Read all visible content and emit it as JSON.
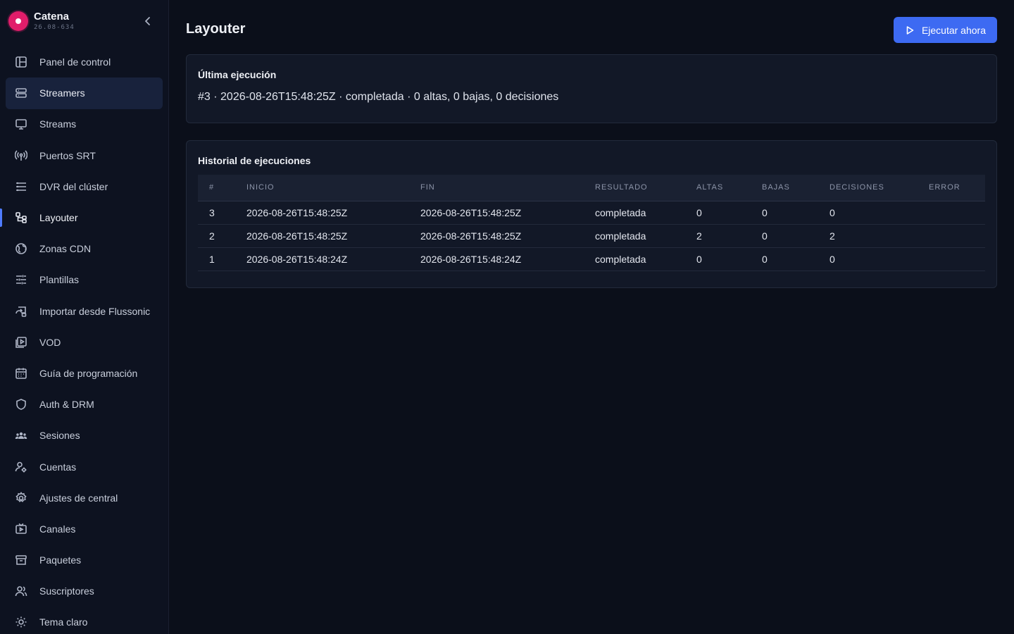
{
  "brand": {
    "name": "Catena",
    "version": "26.08-634",
    "accent": "#e11d6a"
  },
  "sidebar": {
    "items": [
      {
        "label": "Panel de control",
        "icon": "dashboard-icon"
      },
      {
        "label": "Streamers",
        "icon": "server-icon",
        "highlighted": true
      },
      {
        "label": "Streams",
        "icon": "monitor-icon"
      },
      {
        "label": "Puertos SRT",
        "icon": "antenna-icon"
      },
      {
        "label": "DVR del clúster",
        "icon": "database-icon"
      },
      {
        "label": "Layouter",
        "icon": "layout-icon",
        "active": true
      },
      {
        "label": "Zonas CDN",
        "icon": "globe-icon"
      },
      {
        "label": "Plantillas",
        "icon": "sliders-icon"
      },
      {
        "label": "Importar desde Flussonic",
        "icon": "import-icon"
      },
      {
        "label": "VOD",
        "icon": "video-library-icon"
      },
      {
        "label": "Guía de programación",
        "icon": "calendar-icon"
      },
      {
        "label": "Auth & DRM",
        "icon": "shield-icon"
      },
      {
        "label": "Sesiones",
        "icon": "users-group-icon"
      },
      {
        "label": "Cuentas",
        "icon": "user-settings-icon"
      },
      {
        "label": "Ajustes de central",
        "icon": "gear-icon"
      },
      {
        "label": "Canales",
        "icon": "tv-icon"
      },
      {
        "label": "Paquetes",
        "icon": "archive-icon"
      },
      {
        "label": "Suscriptores",
        "icon": "users-icon"
      },
      {
        "label": "Tema claro",
        "icon": "sun-icon"
      }
    ]
  },
  "header": {
    "title": "Layouter",
    "run_button": "Ejecutar ahora"
  },
  "last_run": {
    "title": "Última ejecución",
    "summary": "#3 · 2026-08-26T15:48:25Z · completada · 0 altas, 0 bajas, 0 decisiones"
  },
  "history": {
    "title": "Historial de ejecuciones",
    "columns": [
      "#",
      "INICIO",
      "FIN",
      "RESULTADO",
      "ALTAS",
      "BAJAS",
      "DECISIONES",
      "ERROR"
    ],
    "rows": [
      [
        "3",
        "2026-08-26T15:48:25Z",
        "2026-08-26T15:48:25Z",
        "completada",
        "0",
        "0",
        "0",
        ""
      ],
      [
        "2",
        "2026-08-26T15:48:25Z",
        "2026-08-26T15:48:25Z",
        "completada",
        "2",
        "0",
        "2",
        ""
      ],
      [
        "1",
        "2026-08-26T15:48:24Z",
        "2026-08-26T15:48:24Z",
        "completada",
        "0",
        "0",
        "0",
        ""
      ]
    ]
  },
  "colors": {
    "primary": "#3d6af2",
    "background": "#0b0f1a",
    "sidebar": "#0d1220",
    "card": "#121827"
  }
}
